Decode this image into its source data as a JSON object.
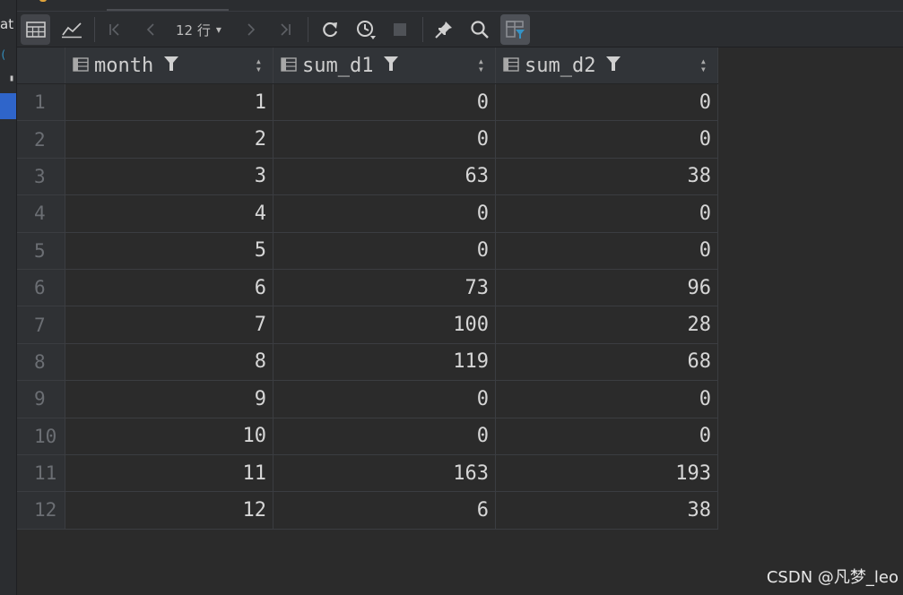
{
  "left_strip": {
    "fragment_1": "at",
    "fragment_2": "("
  },
  "toolbar": {
    "row_count": "12 行",
    "icons": [
      "table-view-icon",
      "chart-view-icon",
      "first-page-icon",
      "prev-page-icon",
      "next-page-icon",
      "last-page-icon",
      "refresh-icon",
      "history-icon",
      "stop-icon",
      "pin-icon",
      "search-icon",
      "filter-panel-icon"
    ]
  },
  "columns": [
    {
      "name": "month"
    },
    {
      "name": "sum_d1"
    },
    {
      "name": "sum_d2"
    }
  ],
  "rows": [
    {
      "index": "1",
      "month": "1",
      "sum_d1": "0",
      "sum_d2": "0"
    },
    {
      "index": "2",
      "month": "2",
      "sum_d1": "0",
      "sum_d2": "0"
    },
    {
      "index": "3",
      "month": "3",
      "sum_d1": "63",
      "sum_d2": "38"
    },
    {
      "index": "4",
      "month": "4",
      "sum_d1": "0",
      "sum_d2": "0"
    },
    {
      "index": "5",
      "month": "5",
      "sum_d1": "0",
      "sum_d2": "0"
    },
    {
      "index": "6",
      "month": "6",
      "sum_d1": "73",
      "sum_d2": "96"
    },
    {
      "index": "7",
      "month": "7",
      "sum_d1": "100",
      "sum_d2": "28"
    },
    {
      "index": "8",
      "month": "8",
      "sum_d1": "119",
      "sum_d2": "68"
    },
    {
      "index": "9",
      "month": "9",
      "sum_d1": "0",
      "sum_d2": "0"
    },
    {
      "index": "10",
      "month": "10",
      "sum_d1": "0",
      "sum_d2": "0"
    },
    {
      "index": "11",
      "month": "11",
      "sum_d1": "163",
      "sum_d2": "193"
    },
    {
      "index": "12",
      "month": "12",
      "sum_d1": "6",
      "sum_d2": "38"
    }
  ],
  "watermark": "CSDN @凡梦_leo",
  "colors": {
    "background": "#2b2b2b",
    "toolbar": "#2b2d30",
    "accent_blue": "#2f65ca",
    "filter_active": "#3592c4"
  }
}
